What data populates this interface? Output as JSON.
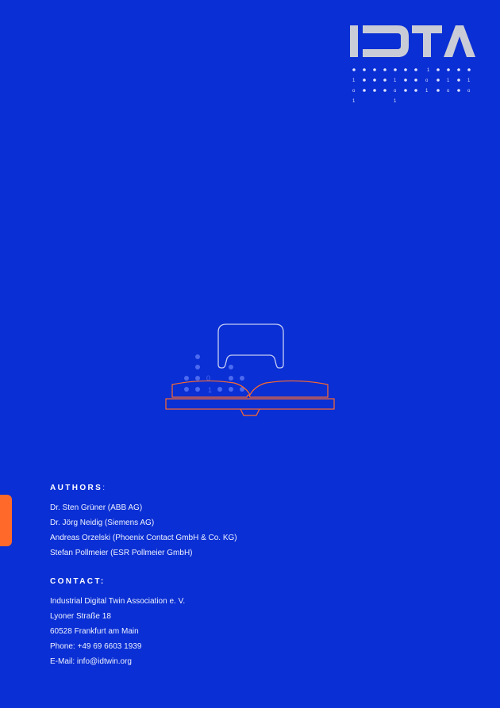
{
  "brand": {
    "logo_text": "IDTA"
  },
  "authors": {
    "heading": "AUTHORS",
    "heading_suffix": ":",
    "names": [
      "Dr. Sten Grüner (ABB AG)",
      "Dr. Jörg Neidig (Siemens AG)",
      "Andreas Orzelski (Phoenix Contact GmbH & Co. KG)",
      "Stefan Pollmeier (ESR Pollmeier GmbH)"
    ]
  },
  "contact": {
    "heading": "CONTACT:",
    "lines": [
      "Industrial Digital Twin Association e. V.",
      "Lyoner Straße 18",
      "60528 Frankfurt am Main",
      "Phone: +49 69 6603 1939",
      "E-Mail: info@idtwin.org"
    ]
  },
  "colors": {
    "background": "#0a2fd4",
    "accent": "#ff6a2b",
    "logo_gray": "#c9ccd6"
  }
}
